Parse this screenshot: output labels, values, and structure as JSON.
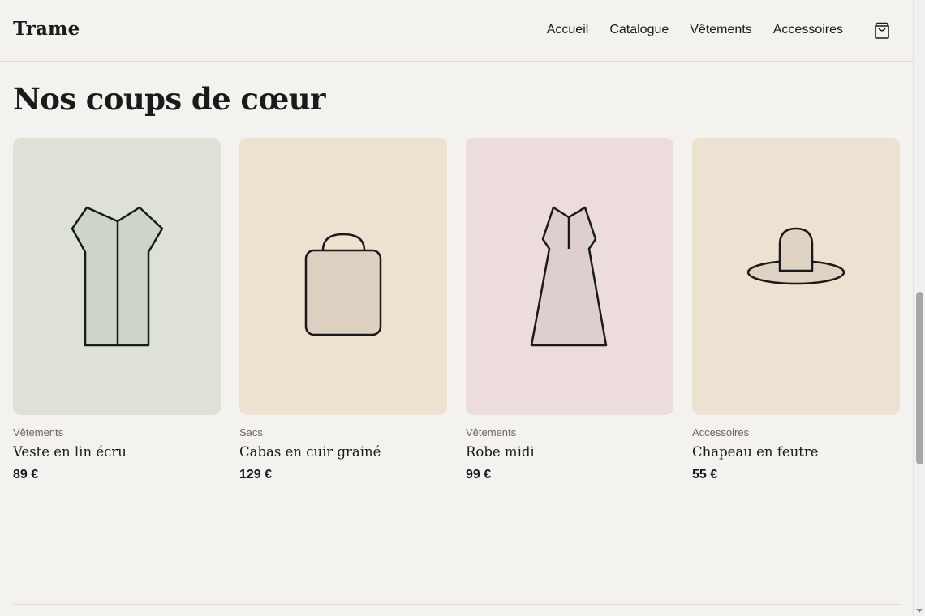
{
  "header": {
    "logo": "Trame",
    "nav": [
      "Accueil",
      "Catalogue",
      "Vêtements",
      "Accessoires"
    ],
    "cart_icon": "shopping-bag-icon"
  },
  "section": {
    "title": "Nos coups de cœur"
  },
  "products": [
    {
      "category": "Vêtements",
      "name": "Veste en lin écru",
      "price": "89 €",
      "bg": "#dde1d6",
      "fill": "#cdd4c8",
      "icon": "jacket-icon"
    },
    {
      "category": "Sacs",
      "name": "Cabas en cuir grainé",
      "price": "129 €",
      "bg": "#ede1d0",
      "fill": "#ddd1c1",
      "icon": "bag-icon"
    },
    {
      "category": "Vêtements",
      "name": "Robe midi",
      "price": "99 €",
      "bg": "#ecdcdb",
      "fill": "#dccfcd",
      "icon": "dress-icon"
    },
    {
      "category": "Accessoires",
      "name": "Chapeau en feutre",
      "price": "55 €",
      "bg": "#ede2d2",
      "fill": "#ded3c4",
      "icon": "hat-icon"
    }
  ]
}
